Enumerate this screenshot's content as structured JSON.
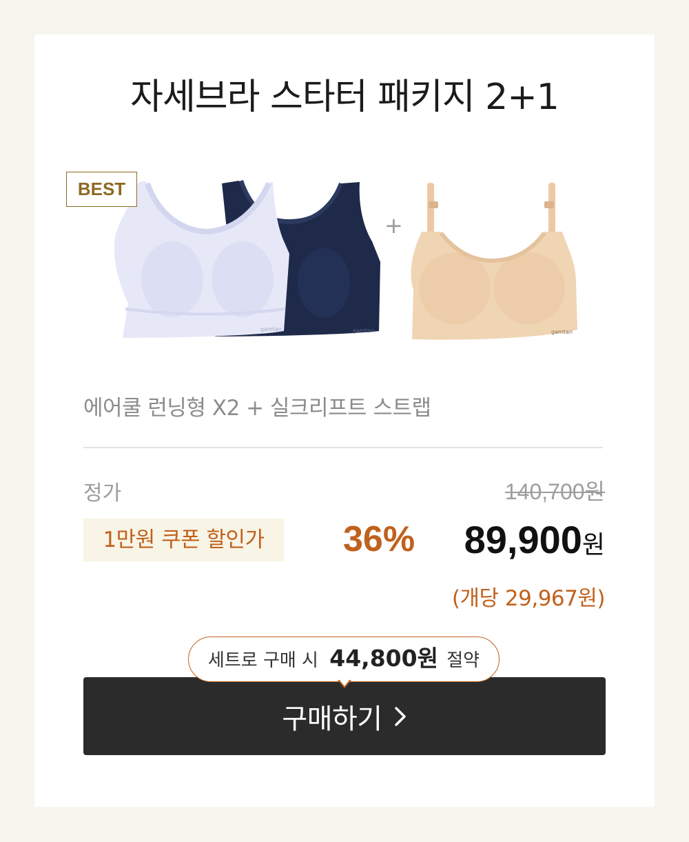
{
  "product": {
    "title": "자세브라 스타터 패키지 2+1",
    "badge": "BEST",
    "plus": "+",
    "description": "에어쿨 런닝형 X2 + 실크리프트 스트랩"
  },
  "pricing": {
    "regular_label": "정가",
    "regular_price": "140,700원",
    "coupon_label": "1만원 쿠폰 할인가",
    "discount_rate": "36%",
    "sale_price": "89,900",
    "sale_currency": "원",
    "unit_price": "(개당 29,967원)"
  },
  "savings": {
    "prefix": "세트로 구매 시",
    "amount": "44,800원",
    "suffix": "절약"
  },
  "cta": {
    "label": "구매하기"
  },
  "colors": {
    "accent": "#c0611c",
    "badge": "#8d6a22",
    "button": "#2b2b2b",
    "bra_lavender": "#e6e8f8",
    "bra_navy": "#1f2a4a",
    "bra_beige": "#f0d5b4"
  }
}
